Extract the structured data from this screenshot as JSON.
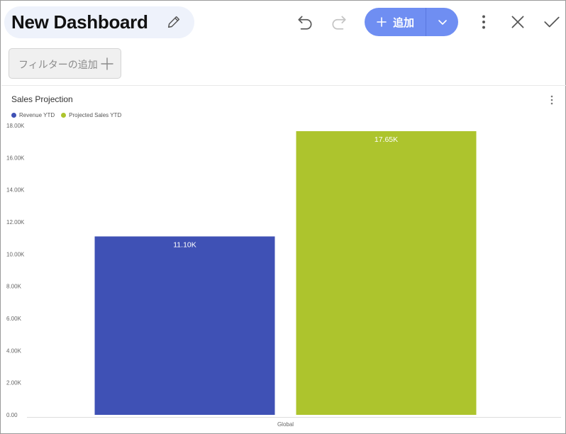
{
  "dashboard": {
    "title": "New Dashboard"
  },
  "toolbar": {
    "add_label": "追加",
    "icons": [
      "pencil-icon",
      "undo-icon",
      "redo-icon",
      "plus-icon",
      "chevron-down-icon",
      "more-vertical-icon",
      "close-icon",
      "check-icon"
    ],
    "accent_color": "#6f8ef2"
  },
  "filter": {
    "add_filter_label": "フィルターの追加"
  },
  "widget": {
    "title": "Sales Projection"
  },
  "chart_data": {
    "type": "bar",
    "title": "Sales Projection",
    "categories": [
      "Global"
    ],
    "series": [
      {
        "name": "Revenue YTD",
        "color": "#3f51b5",
        "values": [
          11100
        ],
        "label": "11.10K"
      },
      {
        "name": "Projected Sales YTD",
        "color": "#adc42d",
        "values": [
          17650
        ],
        "label": "17.65K"
      }
    ],
    "ylim": [
      0,
      18000
    ],
    "y_ticks": [
      0,
      2000,
      4000,
      6000,
      8000,
      10000,
      12000,
      14000,
      16000,
      18000
    ],
    "y_tick_labels": [
      "0.00",
      "2.00K",
      "4.00K",
      "6.00K",
      "8.00K",
      "10.00K",
      "12.00K",
      "14.00K",
      "16.00K",
      "18.00K"
    ],
    "grid": false,
    "legend": "top-left"
  }
}
